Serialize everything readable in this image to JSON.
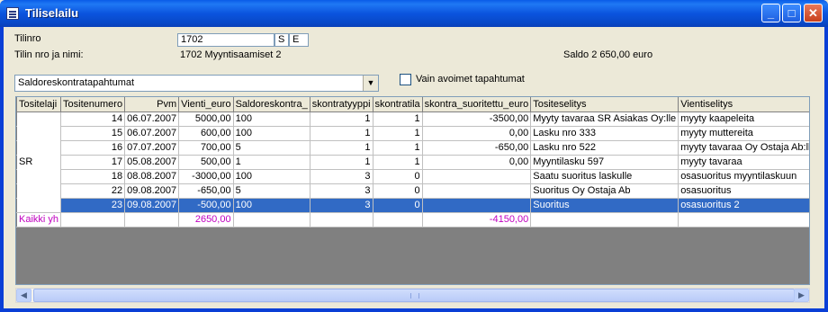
{
  "window": {
    "title": "Tiliselailu"
  },
  "form": {
    "account_no_label": "Tilinro",
    "account_no_value": "1702",
    "account_no_field2": "S",
    "account_no_field3": "E",
    "account_name_label": "Tilin nro ja nimi:",
    "account_name_value": "1702 Myyntisaamiset 2",
    "saldo_text": "Saldo  2 650,00 euro",
    "combo_value": "Saldoreskontratapahtumat",
    "checkbox_label": "Vain avoimet tapahtumat"
  },
  "grid": {
    "headers": [
      "Tositelaji",
      "Tositenumero",
      "Pvm",
      "Vienti_euro",
      "Saldoreskontra_",
      "skontratyyppi",
      "skontratila",
      "skontra_suoritettu_euro",
      "Tositeselitys",
      "Vientiselitys"
    ],
    "group_label": "SR",
    "rows": [
      [
        "",
        "14",
        "06.07.2007",
        "5000,00",
        "100",
        "1",
        "1",
        "-3500,00",
        "Myyty tavaraa SR Asiakas Oy:lle",
        "myyty kaapeleita"
      ],
      [
        "",
        "15",
        "06.07.2007",
        "600,00",
        "100",
        "1",
        "1",
        "0,00",
        "Lasku nro 333",
        "myyty muttereita"
      ],
      [
        "",
        "16",
        "07.07.2007",
        "700,00",
        "5",
        "1",
        "1",
        "-650,00",
        "Lasku nro 522",
        "myyty tavaraa Oy Ostaja Ab:lle"
      ],
      [
        "",
        "17",
        "05.08.2007",
        "500,00",
        "1",
        "1",
        "1",
        "0,00",
        "Myyntilasku 597",
        "myyty tavaraa"
      ],
      [
        "",
        "18",
        "08.08.2007",
        "-3000,00",
        "100",
        "3",
        "0",
        "",
        "Saatu suoritus laskulle",
        "osasuoritus myyntilaskuun"
      ],
      [
        "",
        "22",
        "09.08.2007",
        "-650,00",
        "5",
        "3",
        "0",
        "",
        "Suoritus Oy Ostaja Ab",
        "osasuoritus"
      ],
      [
        "",
        "23",
        "09.08.2007",
        "-500,00",
        "100",
        "3",
        "0",
        "",
        "Suoritus",
        "osasuoritus 2"
      ]
    ],
    "total": {
      "label": "Kaikki yh",
      "vienti": "2650,00",
      "suoritettu": "-4150,00"
    }
  },
  "icons": {
    "minimize": "minimize-icon",
    "maximize": "maximize-icon",
    "close": "close-icon"
  }
}
